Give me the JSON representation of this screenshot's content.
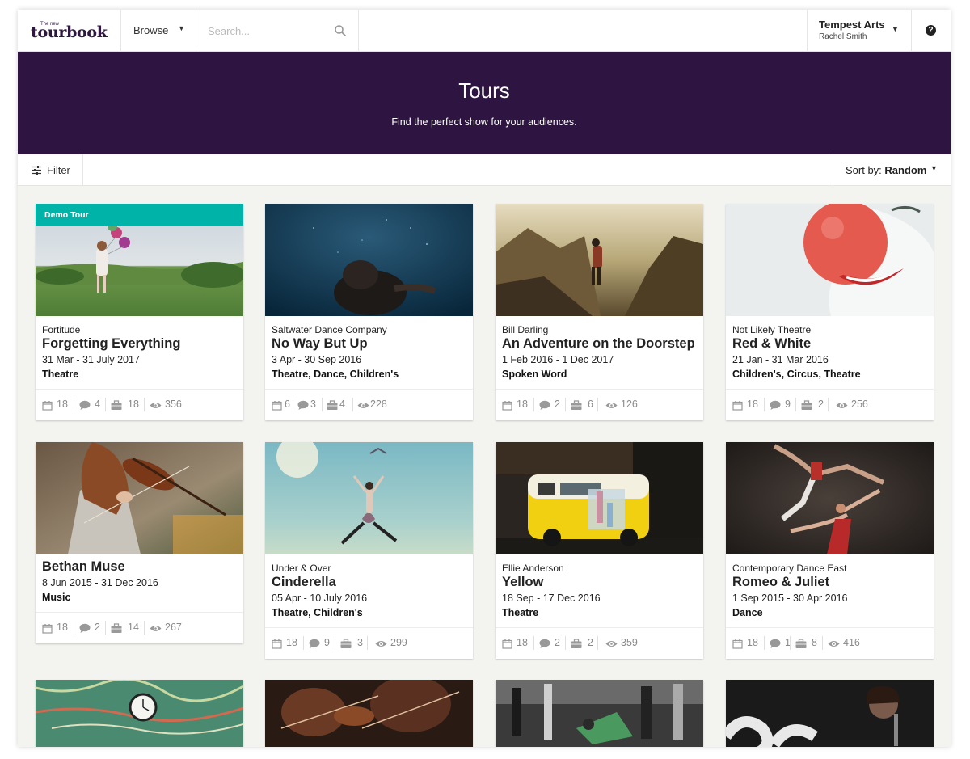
{
  "app": {
    "logo_small": "The new",
    "logo_main": "tourbook"
  },
  "nav": {
    "browse_label": "Browse",
    "search_placeholder": "Search...",
    "account_org": "Tempest Arts",
    "account_user": "Rachel Smith",
    "help_glyph": "?"
  },
  "hero": {
    "title": "Tours",
    "subtitle": "Find the perfect show for your audiences."
  },
  "toolbar": {
    "filter_label": "Filter",
    "sort_prefix": "Sort by:",
    "sort_value": "Random"
  },
  "tours": [
    {
      "badge": "Demo Tour",
      "company": "Fortitude",
      "title": "Forgetting Everything",
      "dates": "31 Mar - 31 July 2017",
      "genres": "Theatre",
      "stats": {
        "dates": "18",
        "comments": "4",
        "bookings": "18",
        "views": "356"
      }
    },
    {
      "company": "Saltwater Dance Company",
      "title": "No Way But Up",
      "dates": "3 Apr - 30 Sep 2016",
      "genres": "Theatre, Dance, Children's",
      "stats": {
        "dates": "6",
        "comments": "3",
        "bookings": "4",
        "views": "228"
      }
    },
    {
      "company": "Bill Darling",
      "title": "An Adventure on the Doorstep",
      "dates": "1 Feb 2016 - 1 Dec 2017",
      "genres": "Spoken Word",
      "stats": {
        "dates": "18",
        "comments": "2",
        "bookings": "6",
        "views": "126"
      }
    },
    {
      "company": "Not Likely Theatre",
      "title": "Red & White",
      "dates": "21 Jan - 31 Mar 2016",
      "genres": "Children's, Circus, Theatre",
      "stats": {
        "dates": "18",
        "comments": "9",
        "bookings": "2",
        "views": "256"
      }
    },
    {
      "company": "",
      "title": "Bethan Muse",
      "dates": "8 Jun 2015 - 31 Dec 2016",
      "genres": "Music",
      "stats": {
        "dates": "18",
        "comments": "2",
        "bookings": "14",
        "views": "267"
      }
    },
    {
      "company": "Under & Over",
      "title": "Cinderella",
      "dates": "05 Apr - 10 July 2016",
      "genres": "Theatre, Children's",
      "stats": {
        "dates": "18",
        "comments": "9",
        "bookings": "3",
        "views": "299"
      }
    },
    {
      "company": "Ellie Anderson",
      "title": "Yellow",
      "dates": "18 Sep - 17 Dec 2016",
      "genres": "Theatre",
      "stats": {
        "dates": "18",
        "comments": "2",
        "bookings": "2",
        "views": "359"
      }
    },
    {
      "company": "Contemporary Dance East",
      "title": "Romeo & Juliet",
      "dates": "1 Sep 2015 - 30 Apr 2016",
      "genres": "Dance",
      "stats": {
        "dates": "18",
        "comments": "1",
        "bookings": "8",
        "views": "416"
      }
    }
  ],
  "colors": {
    "brand_purple": "#2e1541",
    "demo_badge": "#00b3a9",
    "stat_grey": "#8a8a8a"
  },
  "icons": {
    "dates": "calendar-icon",
    "comments": "comment-icon",
    "bookings": "briefcase-icon",
    "views": "eye-icon"
  }
}
